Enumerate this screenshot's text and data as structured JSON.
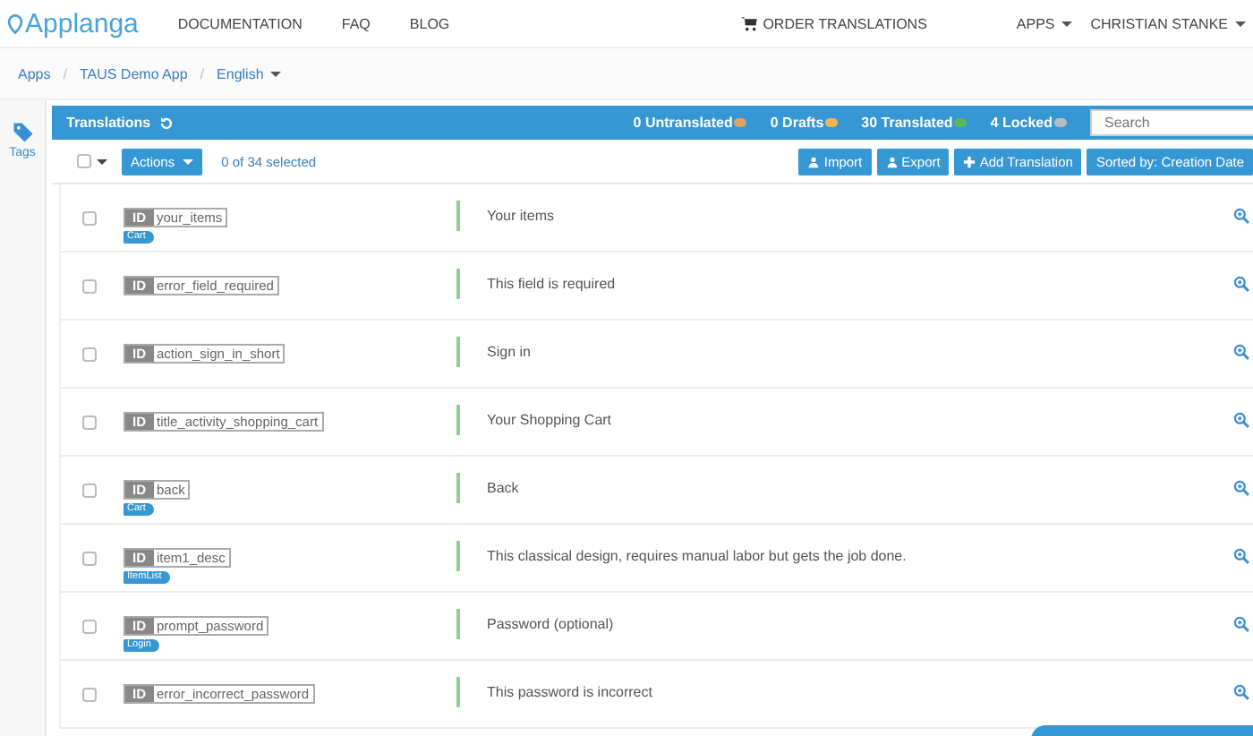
{
  "navbar": {
    "logo": "Applanga",
    "links": [
      "DOCUMENTATION",
      "FAQ",
      "BLOG"
    ],
    "order": "ORDER TRANSLATIONS",
    "menus": [
      "APPS",
      "CHRISTIAN STANKE"
    ]
  },
  "breadcrumb": {
    "separator": "/",
    "items": [
      {
        "label": "Apps",
        "dropdown": false
      },
      {
        "label": "TAUS Demo App",
        "dropdown": false
      },
      {
        "label": "English",
        "dropdown": true
      }
    ]
  },
  "sidebar": {
    "items": [
      {
        "label": "Tags"
      }
    ]
  },
  "panel": {
    "title": "Translations",
    "counts": [
      {
        "label": "0 Untranslated",
        "color": "#d9a36a"
      },
      {
        "label": "0 Drafts",
        "color": "#f0b450"
      },
      {
        "label": "30 Translated",
        "color": "#5cb85c"
      },
      {
        "label": "4 Locked",
        "color": "#b8bcc0"
      }
    ],
    "search": {
      "placeholder": "Search"
    }
  },
  "toolbar": {
    "select_all": {
      "checked": false
    },
    "actions": "Actions",
    "selection": "0 of 34 selected",
    "buttons": [
      {
        "kind": "import",
        "label": "Import"
      },
      {
        "kind": "export",
        "label": "Export"
      },
      {
        "kind": "add",
        "label": "Add Translation"
      },
      {
        "kind": "sort",
        "label": "Sorted by: Creation Date"
      }
    ]
  },
  "rows": [
    {
      "checked": false,
      "id_label": "ID",
      "key": "your_items",
      "tag": "Cart",
      "text": "Your items"
    },
    {
      "checked": false,
      "id_label": "ID",
      "key": "error_field_required",
      "text": "This field is required"
    },
    {
      "checked": false,
      "id_label": "ID",
      "key": "action_sign_in_short",
      "text": "Sign in"
    },
    {
      "checked": false,
      "id_label": "ID",
      "key": "title_activity_shopping_cart",
      "text": "Your Shopping Cart"
    },
    {
      "checked": false,
      "id_label": "ID",
      "key": "back",
      "tag": "Cart",
      "text": "Back"
    },
    {
      "checked": false,
      "id_label": "ID",
      "key": "item1_desc",
      "tag": "ItemList",
      "text": "This classical design, requires manual labor but gets the job done."
    },
    {
      "checked": false,
      "id_label": "ID",
      "key": "prompt_password",
      "tag": "Login",
      "text": "Password (optional)"
    },
    {
      "checked": false,
      "id_label": "ID",
      "key": "error_incorrect_password",
      "text": "This password is incorrect"
    }
  ]
}
